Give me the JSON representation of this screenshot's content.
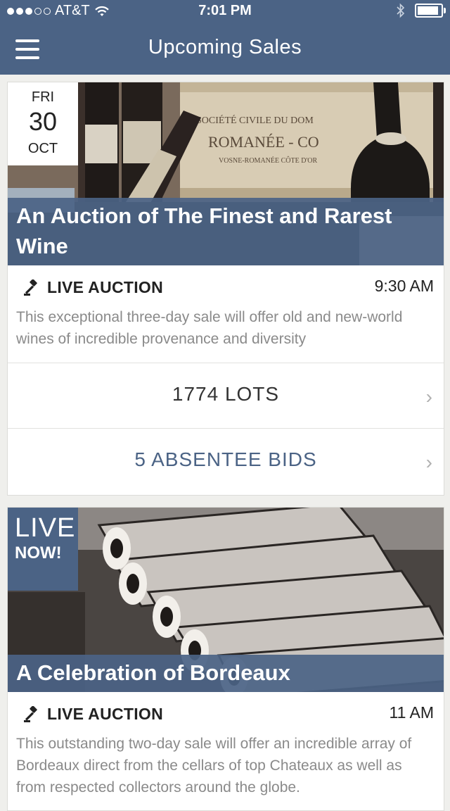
{
  "status_bar": {
    "carrier": "AT&T",
    "time": "7:01 PM",
    "signal_filled": 3,
    "signal_total": 5,
    "battery_level": 0.9
  },
  "nav": {
    "title": "Upcoming Sales",
    "menu_icon": "hamburger-menu-icon"
  },
  "colors": {
    "brand": "#4b6385",
    "background": "#efefec",
    "muted_text": "#8a8a8a"
  },
  "sales": [
    {
      "date": {
        "dow": "FRI",
        "day": "30",
        "month": "OCT"
      },
      "title": "An Auction of The Finest and Rarest Wine",
      "type_icon": "gavel-icon",
      "type": "LIVE AUCTION",
      "time": "9:30 AM",
      "description": "This exceptional three-day sale will offer old and new-world wines of incredible provenance and diversity",
      "lots_label": "1774 LOTS",
      "bids_label": "5 ABSENTEE BIDS"
    },
    {
      "live_badge": {
        "line1": "LIVE",
        "line2": "NOW!"
      },
      "title": "A Celebration of Bordeaux",
      "type_icon": "gavel-icon",
      "type": "LIVE AUCTION",
      "time": "11 AM",
      "description": "This outstanding two-day sale will offer an incredible array of Bordeaux direct from the cellars of top Chateaux as well as from respected collectors around the globe."
    }
  ]
}
